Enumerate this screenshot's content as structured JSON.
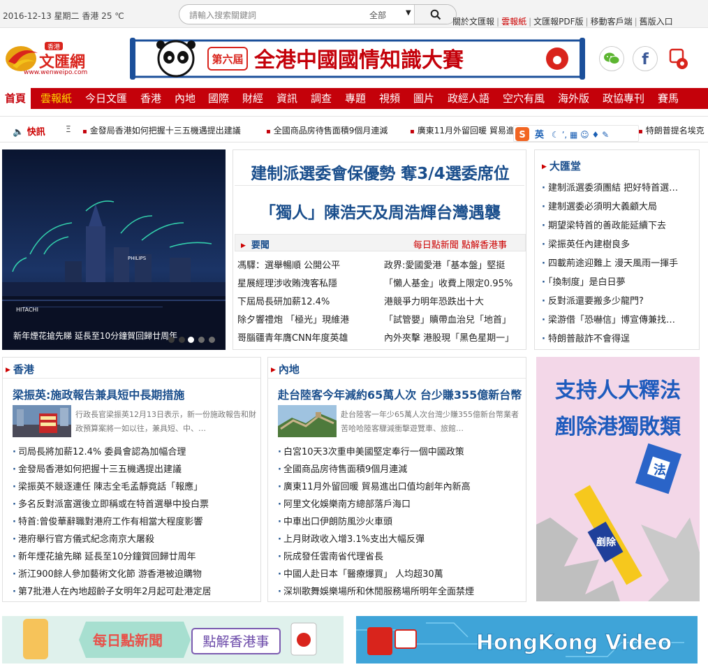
{
  "topbar": {
    "date": "2016-12-13 星期二 香港 25 ℃",
    "search_placeholder": "請輸入搜索關鍵詞",
    "search_scope": "全部",
    "links": [
      "關於文匯報",
      "雲報紙",
      "文匯報PDF版",
      "移動客戶端",
      "舊版入口"
    ]
  },
  "logo": {
    "brand": "文匯網",
    "region": "香港",
    "url_text": "www.wenweipo.com"
  },
  "banner": {
    "badge": "第六屆",
    "text": "全港中國國情知識大賽"
  },
  "nav": {
    "items": [
      "首頁",
      "雲報紙",
      "今日文匯",
      "香港",
      "內地",
      "國際",
      "財經",
      "資訊",
      "調查",
      "專題",
      "視頻",
      "圖片",
      "政經人語",
      "空穴有風",
      "海外版",
      "政協專刊",
      "賽馬"
    ],
    "active": "首頁",
    "highlight": "雲報紙"
  },
  "ticker": {
    "label": "快訊",
    "items": [
      "金發局香港如何把握十三五機遇提出建議",
      "全國商品房待售面積9個月連減",
      "廣東11月外留回暖 貿易進出口值均創年內新",
      "特朗普提名埃克"
    ]
  },
  "slider": {
    "caption": "新年煙花搶先睇 延長至10分鐘賀回歸廿周年",
    "dots": 4,
    "active_dot": 0
  },
  "headlines": {
    "top1": "建制派選委會保優勢 奪3/4選委席位",
    "top2": "「獨人」陳浩天及周浩輝台灣遇襲",
    "yaowen_title": "要聞",
    "yaowen_right": "每日點新聞 點解香港事",
    "left": [
      "馮驛：選舉暢順 公開公平",
      "星展經理涉收賄洩客私隱",
      "下屆局長研加薪12.4%",
      "除夕響禮炮 「極光」現維港",
      "哥腦疆青年膺CNN年度英雄"
    ],
    "right": [
      "政界:愛國愛港「基本盤」堅挺",
      "「懶人基金」收費上限定0.95%",
      "港競爭力明年恐跌出十大",
      "「試管嬰」贖帶血治兒「地首」",
      "內外夾擊 港股現「黑色星期一」"
    ]
  },
  "dahuitang": {
    "title": "大匯堂",
    "items": [
      "建制派選委須團結 把好特首選…",
      "建制選委必須明大義顧大局",
      "期望梁特首的善政能延續下去",
      "梁振英任內建樹良多",
      "四載荊途迎難上 漫天風雨一揮手",
      "「換制度」是白日夢",
      "反對派還要搬多少龍門?",
      "梁游借「恐嚇信」博宣傳兼找…",
      "特朗普敲詐不會得逞"
    ]
  },
  "hongkong": {
    "title": "香港",
    "lead": "梁振英:施政報告兼具短中長期措施",
    "summary": "行政長官梁振英12月13日表示，新一份施政報告和財政預算案將一如以往，兼具短、中、…",
    "items": [
      "司局長將加薪12.4% 委員會認為加幅合理",
      "金發局香港如何把握十三五機遇提出建議",
      "梁振英不競逐連任 陳志全毛孟靜竟話「報應」",
      "多名反對派富選後立即稱或在特首選舉中投白票",
      "特首:曾俊華辭職對港府工作有相當大程度影響",
      "港府舉行官方儀式紀念南京大屠殺",
      "新年煙花搶先睇 延長至10分鐘賀回歸廿周年",
      "浙江900餘人參加藝術文化節 游香港被迫購物",
      "第7批港人在內地超齡子女明年2月起可赴港定居"
    ]
  },
  "mainland": {
    "title": "內地",
    "lead": "赴台陸客今年減約65萬人次 台少賺355億新台幣",
    "summary": "赴台陸客一年少65萬人次台灣少賺355億新台幣業者苦哈哈陸客驟減衝擊遊覽車、旅館…",
    "items": [
      "白宮10天3次重申美國堅定奉行一個中國政策",
      "全國商品房待售面積9個月連減",
      "廣東11月外留回暖 貿易進出口值均創年內新高",
      "阿里文化娛樂南方總部落戶海口",
      "中車出口伊朗防風沙火車頭",
      "上月財政收入增3.1%支出大幅反彈",
      "阮成發任雲南省代理省長",
      "中國人赴日本「醫療爆買」 人均超30萬",
      "深圳歌舞娛樂場所和休閒服務場所明年全面禁煙"
    ]
  },
  "promo": {
    "line1": "支持人大釋法",
    "line2": "剷除港獨敗類",
    "book_label": "法",
    "stick_label": "剷除"
  },
  "ads": {
    "left_main": "每日點新聞",
    "left_sub": "點解香港事",
    "right_text": "HongKong Video"
  },
  "ime": {
    "label": "英"
  },
  "colors": {
    "brand_red": "#c4010a",
    "headline_blue": "#1a4e8c",
    "highlight_gold": "#ffd800"
  }
}
